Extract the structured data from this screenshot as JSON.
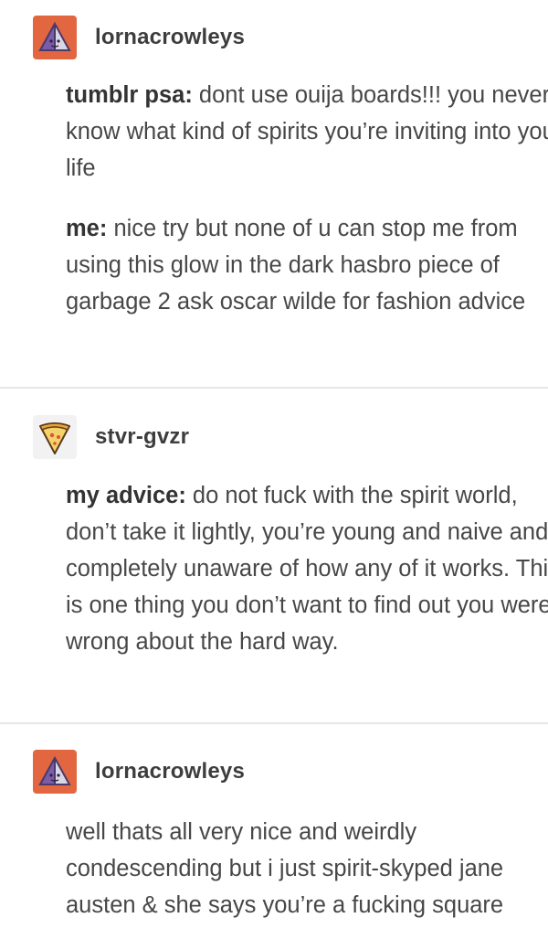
{
  "colors": {
    "avatar_orange": "#e2663f",
    "avatar_triangle": "#7a5ca8",
    "pizza_crust": "#e9a23b",
    "pizza_cheese": "#f5d36b",
    "divider": "#e6e6e6",
    "text": "#474747"
  },
  "posts": [
    {
      "avatar_icon": "triangle-avatar-icon",
      "username": "lornacrowleys",
      "paragraphs": [
        {
          "bold": "tumblr psa:",
          "text": " dont use ouija boards!!! you never know what kind of spirits you’re inviting into your life"
        },
        {
          "bold": "me:",
          "text": " nice try but none of u can stop me from using this glow in the dark hasbro piece of garbage 2 ask oscar wilde for fashion advice"
        }
      ]
    },
    {
      "avatar_icon": "pizza-avatar-icon",
      "username": "stvr-gvzr",
      "paragraphs": [
        {
          "bold": "my advice:",
          "text": " do not fuck with the spirit world, don’t take it lightly, you’re young and naive and completely unaware of how any of it works. This is one thing you don’t want to find out you were wrong about the hard way."
        }
      ]
    },
    {
      "avatar_icon": "triangle-avatar-icon",
      "username": "lornacrowleys",
      "paragraphs": [
        {
          "bold": "",
          "text": "well thats all very nice and weirdly condescending but i just spirit-skyped jane austen & she says you’re a fucking square"
        }
      ]
    }
  ]
}
